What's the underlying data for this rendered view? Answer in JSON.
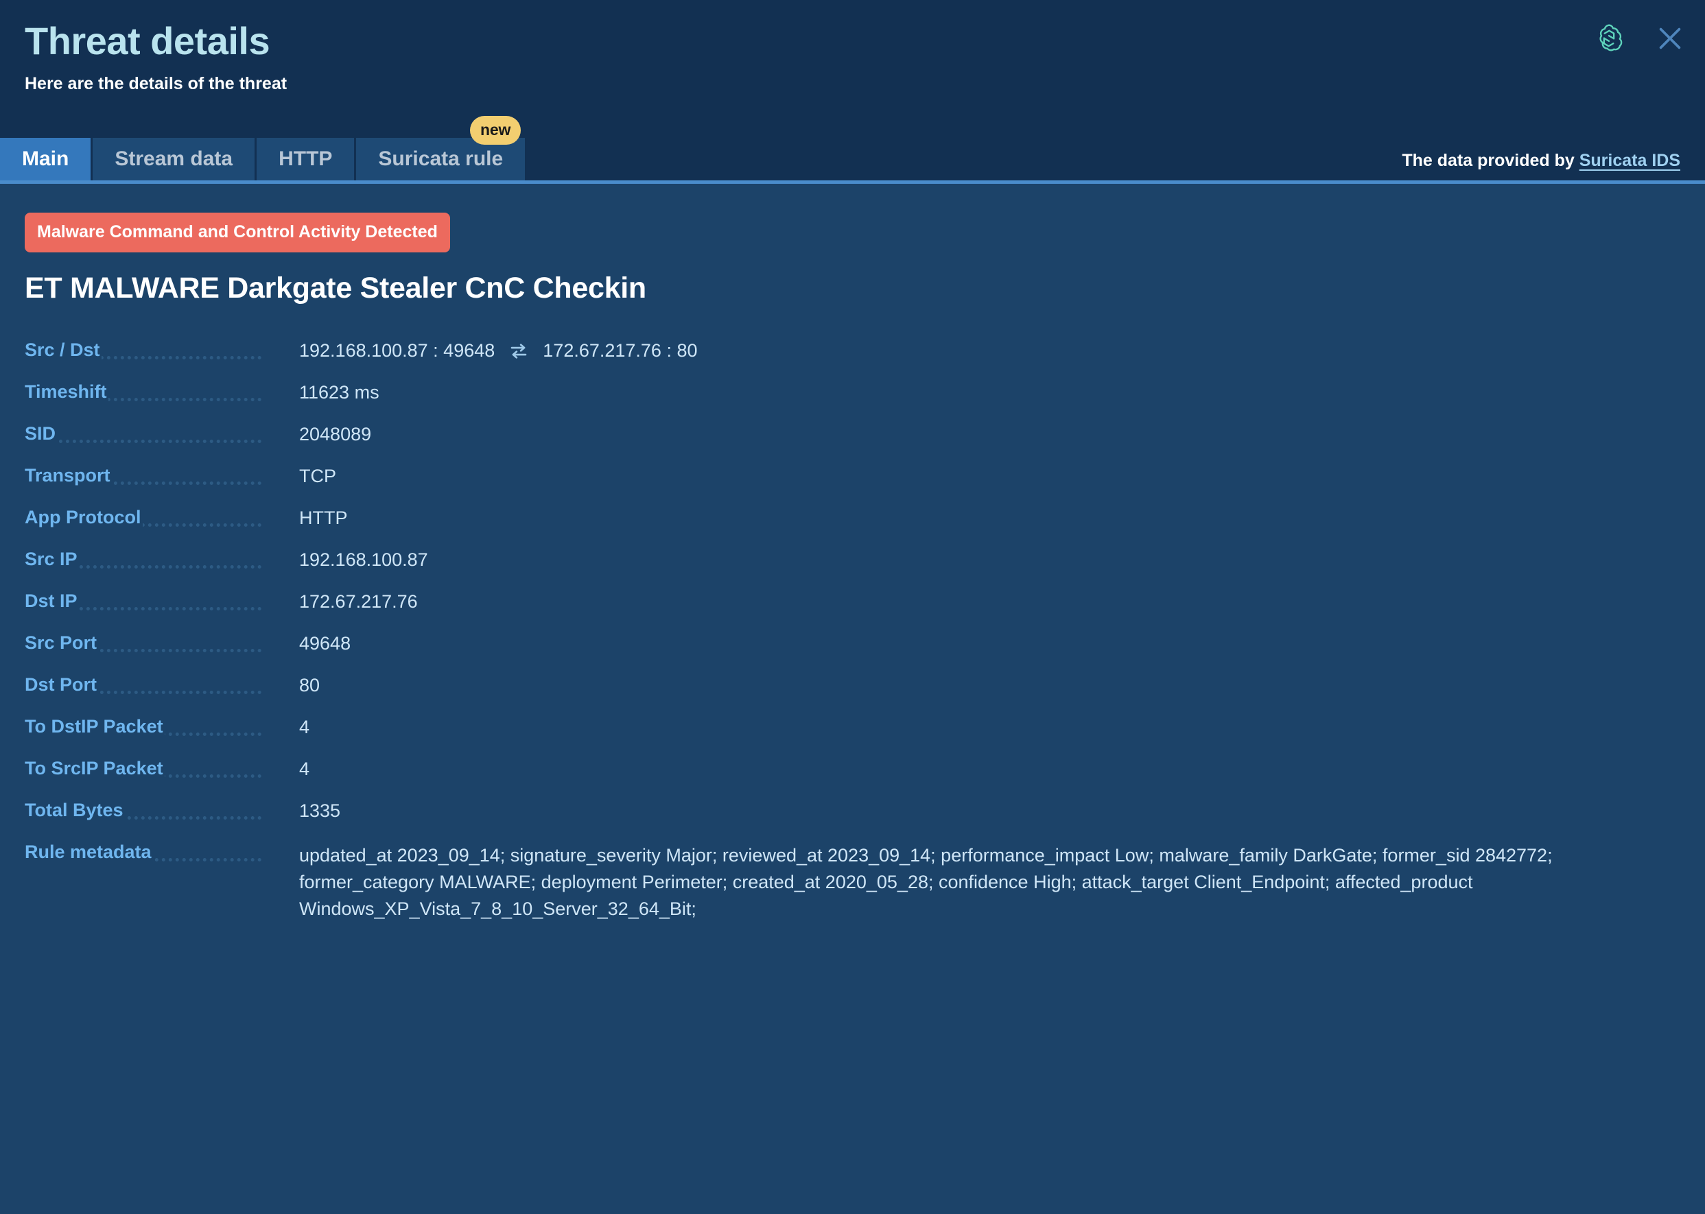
{
  "header": {
    "title": "Threat details",
    "subtitle": "Here are the details of the threat",
    "brand_icon": "openai-logo-icon",
    "close_icon": "close-icon",
    "accent_color": "#4a8ccb",
    "title_color": "#b9e3ee"
  },
  "tabs": {
    "items": [
      {
        "label": "Main",
        "active": true
      },
      {
        "label": "Stream data",
        "active": false
      },
      {
        "label": "HTTP",
        "active": false
      },
      {
        "label": "Suricata rule",
        "active": false,
        "badge": "new"
      }
    ],
    "provider_prefix": "The data provided by",
    "provider_link": "Suricata IDS"
  },
  "alert": {
    "badge_text": "Malware Command and Control Activity Detected",
    "badge_color": "#ec6a5e",
    "title": "ET MALWARE Darkgate Stealer CnC Checkin"
  },
  "details": {
    "src_dst": {
      "label": "Src / Dst",
      "source": "192.168.100.87 : 49648",
      "destination": "172.67.217.76 : 80",
      "icon": "exchange-arrows-icon"
    },
    "rows": [
      {
        "label": "Timeshift",
        "value": "11623 ms"
      },
      {
        "label": "SID",
        "value": "2048089"
      },
      {
        "label": "Transport",
        "value": "TCP"
      },
      {
        "label": "App Protocol",
        "value": "HTTP"
      },
      {
        "label": "Src IP",
        "value": "192.168.100.87"
      },
      {
        "label": "Dst IP",
        "value": "172.67.217.76"
      },
      {
        "label": "Src Port",
        "value": "49648"
      },
      {
        "label": "Dst Port",
        "value": "80"
      },
      {
        "label": "To DstIP Packet",
        "value": "4"
      },
      {
        "label": "To SrcIP Packet",
        "value": "4"
      },
      {
        "label": "Total Bytes",
        "value": "1335"
      }
    ],
    "rule_metadata": {
      "label": "Rule metadata",
      "value": "updated_at 2023_09_14; signature_severity Major; reviewed_at 2023_09_14; performance_impact Low; malware_family DarkGate; former_sid 2842772; former_category MALWARE; deployment Perimeter; created_at 2020_05_28; confidence High; attack_target Client_Endpoint; affected_product Windows_XP_Vista_7_8_10_Server_32_64_Bit;"
    }
  }
}
